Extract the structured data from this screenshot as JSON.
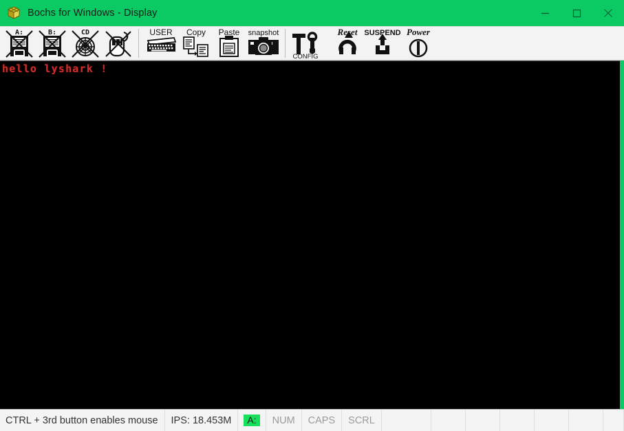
{
  "window": {
    "title": "Bochs for Windows - Display",
    "icon": "bochs-logo-icon",
    "titlebar_color": "#0bca63",
    "controls": [
      {
        "name": "minimize-button",
        "glyph": "minimize-icon",
        "label": "—"
      },
      {
        "name": "maximize-button",
        "glyph": "maximize-icon",
        "label": "□"
      },
      {
        "name": "close-button",
        "glyph": "close-icon",
        "label": "×"
      }
    ]
  },
  "toolbar": {
    "buttons": [
      {
        "name": "floppy-a-button",
        "icon": "floppy-disk-a-icon",
        "label": "A:",
        "disabled": true
      },
      {
        "name": "floppy-b-button",
        "icon": "floppy-disk-b-icon",
        "label": "B:",
        "disabled": true
      },
      {
        "name": "cdrom-button",
        "icon": "cdrom-disc-icon",
        "label": "CD",
        "disabled": true
      },
      {
        "name": "mouse-button",
        "icon": "mouse-icon",
        "label": "",
        "disabled": true
      },
      {
        "name": "user-button",
        "icon": "keyboard-icon",
        "label": "USER",
        "disabled": false
      },
      {
        "name": "copy-button",
        "icon": "copy-icon",
        "label": "Copy",
        "disabled": false
      },
      {
        "name": "paste-button",
        "icon": "paste-icon",
        "label": "Paste",
        "disabled": false
      },
      {
        "name": "snapshot-button",
        "icon": "camera-icon",
        "label": "snapshot",
        "disabled": false
      },
      {
        "name": "config-button",
        "icon": "hammer-wrench-icon",
        "label": "CONFIG",
        "disabled": false
      },
      {
        "name": "reset-button",
        "icon": "reset-arrow-icon",
        "label": "Reset",
        "disabled": false
      },
      {
        "name": "suspend-button",
        "icon": "suspend-icon",
        "label": "SUSPEND",
        "disabled": false
      },
      {
        "name": "power-button",
        "icon": "power-icon",
        "label": "Power",
        "disabled": false
      }
    ]
  },
  "display": {
    "background_color": "#000000",
    "text_color": "#d42c2c",
    "lines": [
      "hello lyshark !"
    ]
  },
  "statusbar": {
    "hint": "CTRL + 3rd button enables mouse",
    "ips": "IPS: 18.453M",
    "drive_led": "A:",
    "drive_led_color": "#16e05c",
    "keys": [
      {
        "name": "num-lock-indicator",
        "label": "NUM"
      },
      {
        "name": "caps-lock-indicator",
        "label": "CAPS"
      },
      {
        "name": "scroll-lock-indicator",
        "label": "SCRL"
      }
    ],
    "empty_panels": 7
  }
}
